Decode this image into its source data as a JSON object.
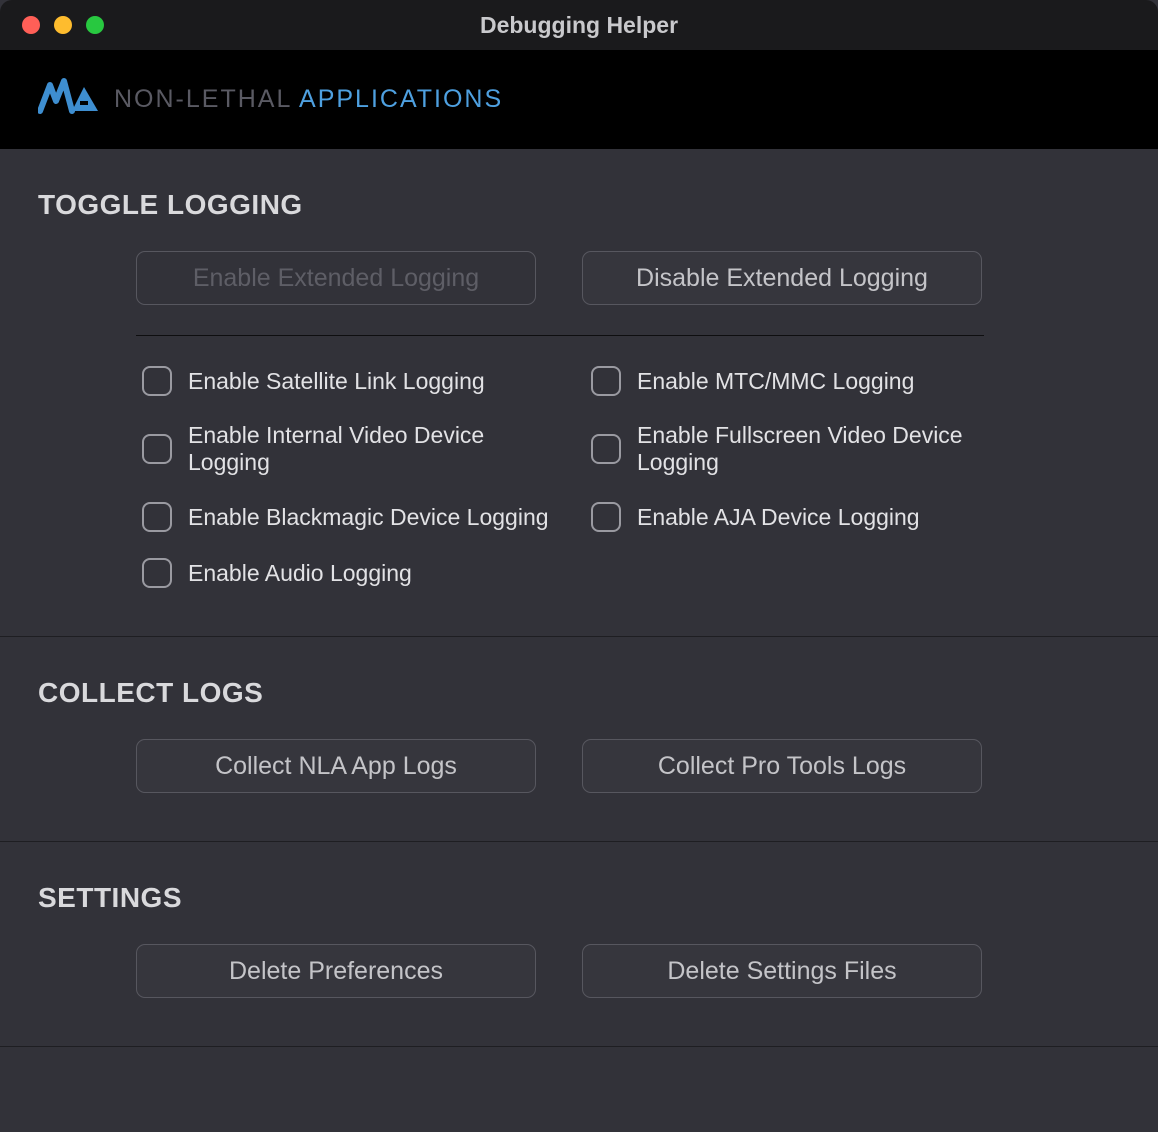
{
  "titlebar": {
    "title": "Debugging Helper"
  },
  "brand": {
    "grey": "NON-LETHAL ",
    "blue": "APPLICATIONS"
  },
  "sections": {
    "toggle": {
      "heading": "TOGGLE LOGGING",
      "btn_enable": "Enable Extended Logging",
      "btn_disable": "Disable Extended Logging",
      "checks": {
        "satellite": "Enable Satellite Link Logging",
        "mtc": "Enable MTC/MMC Logging",
        "internal_video": "Enable Internal Video Device Logging",
        "fullscreen_video": "Enable Fullscreen Video Device Logging",
        "blackmagic": "Enable Blackmagic Device Logging",
        "aja": "Enable AJA Device Logging",
        "audio": "Enable Audio Logging"
      }
    },
    "collect": {
      "heading": "COLLECT LOGS",
      "btn_nla": "Collect NLA App Logs",
      "btn_pro": "Collect Pro Tools Logs"
    },
    "settings": {
      "heading": "SETTINGS",
      "btn_prefs": "Delete Preferences",
      "btn_files": "Delete Settings Files"
    }
  }
}
